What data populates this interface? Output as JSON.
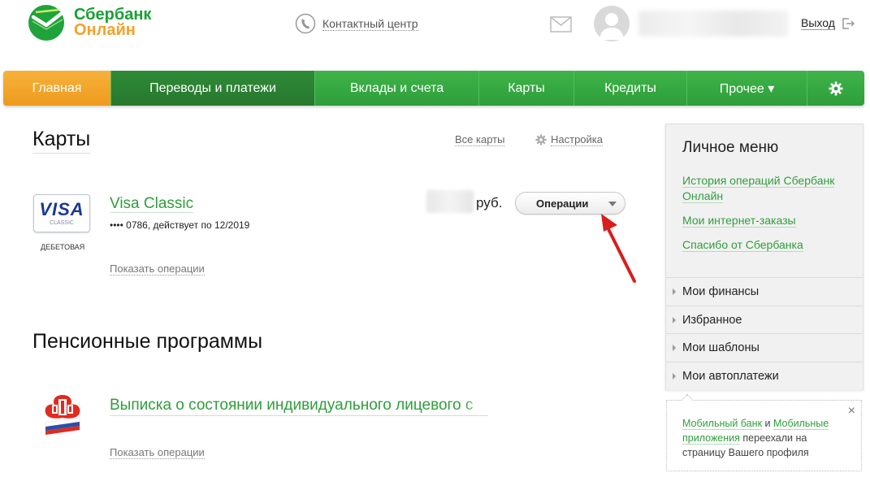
{
  "header": {
    "logo_line1": "Сбербанк",
    "logo_line2": "Онлайн",
    "contact_center": "Контактный центр",
    "logout": "Выход"
  },
  "nav": {
    "items": [
      {
        "label": "Главная"
      },
      {
        "label": "Переводы и платежи"
      },
      {
        "label": "Вклады и счета"
      },
      {
        "label": "Карты"
      },
      {
        "label": "Кредиты"
      },
      {
        "label": "Прочее ▾"
      }
    ],
    "settings_icon": "gear-icon"
  },
  "cards": {
    "title": "Карты",
    "all_cards": "Все карты",
    "settings": "Настройка",
    "card": {
      "logo_word": "VISA",
      "logo_sub": "CLASSIC",
      "type": "ДЕБЕТОВАЯ",
      "name": "Visa Classic",
      "number": "•••• 0786, действует по 12/2019",
      "currency": "руб.",
      "operations_button": "Операции",
      "show_operations": "Показать операции"
    }
  },
  "pension": {
    "title": "Пенсионные программы",
    "link": "Выписка о состоянии индивидуального лицевого с",
    "show_operations": "Показать операции"
  },
  "sidebar": {
    "title": "Личное меню",
    "links": [
      {
        "label": "История операций Сбербанк Онлайн"
      },
      {
        "label": "Мои интернет-заказы"
      },
      {
        "label": "Спасибо от Сбербанка"
      }
    ],
    "sections": [
      {
        "label": "Мои финансы"
      },
      {
        "label": "Избранное"
      },
      {
        "label": "Мои шаблоны"
      },
      {
        "label": "Мои автоплатежи"
      }
    ]
  },
  "notice": {
    "link1": "Мобильный банк",
    "and": " и ",
    "link2": "Мобильные приложения",
    "rest": " переехали на страницу Вашего профиля",
    "close": "×"
  },
  "colors": {
    "brand_green": "#2f9e3c",
    "brand_orange": "#f2a22a",
    "nav_active": "#2f8a37",
    "arrow_red": "#d81e1e"
  }
}
